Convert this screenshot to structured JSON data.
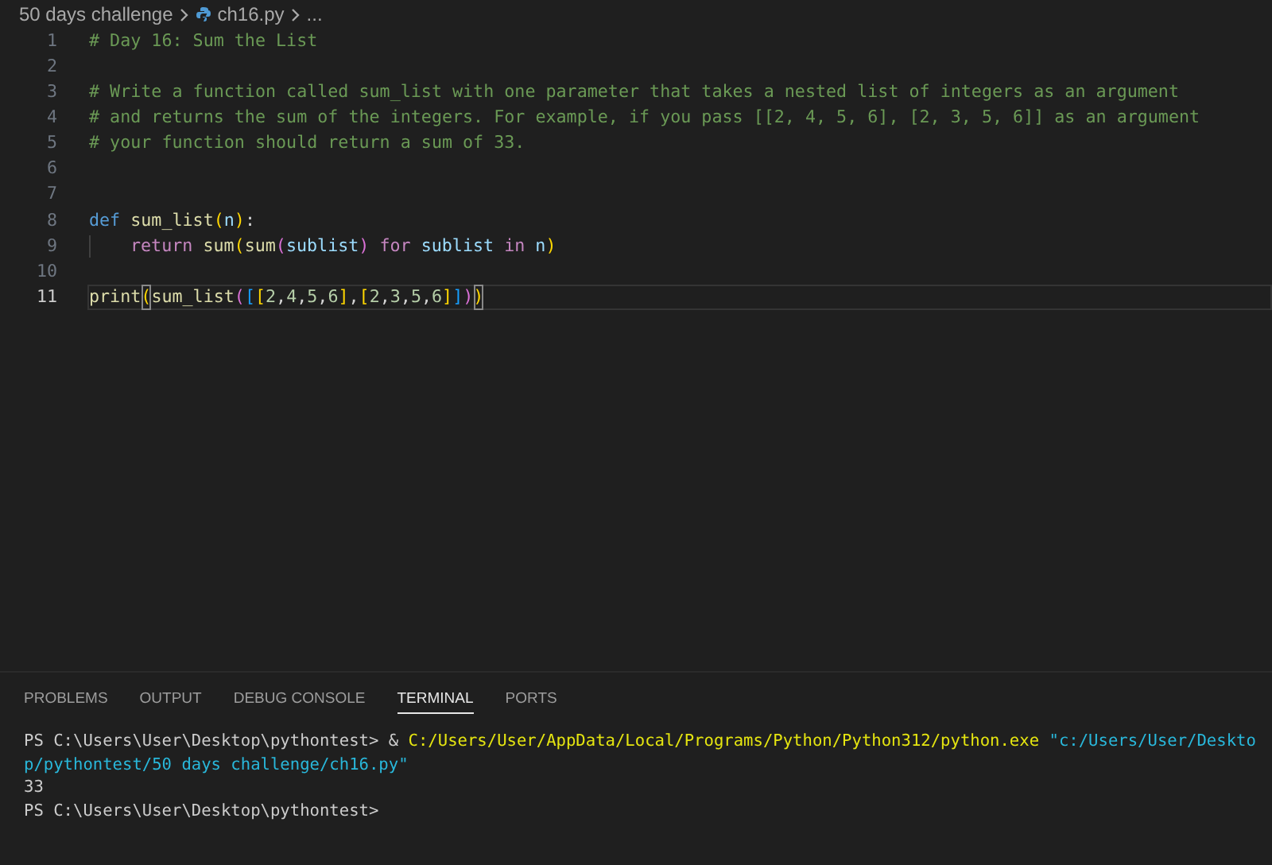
{
  "breadcrumb": [
    {
      "label": "50 days challenge",
      "kind": "folder"
    },
    {
      "label": "ch16.py",
      "kind": "file"
    },
    {
      "label": "...",
      "kind": "more"
    }
  ],
  "editor": {
    "lines": [
      {
        "number": "1",
        "current": false,
        "tokens": [
          {
            "text": "# Day 16: Sum the List",
            "kind": "comment"
          }
        ]
      },
      {
        "number": "2",
        "current": false
      },
      {
        "number": "3",
        "current": false,
        "tokens": [
          {
            "text": "# Write a function called sum_list with one parameter that takes a nested list of integers as an argument",
            "kind": "comment"
          }
        ]
      },
      {
        "number": "4",
        "current": false,
        "tokens": [
          {
            "text": "# and returns the sum of the integers. For example, if you pass [[2, 4, 5, 6], [2, 3, 5, 6]] as an argument",
            "kind": "comment"
          }
        ]
      },
      {
        "number": "5",
        "current": false,
        "tokens": [
          {
            "text": "# your function should return a sum of 33.",
            "kind": "comment"
          }
        ]
      },
      {
        "number": "6",
        "current": false
      },
      {
        "number": "7",
        "current": false
      },
      {
        "number": "8",
        "current": false,
        "tokens": [
          {
            "text": "def ",
            "kind": "keyword"
          },
          {
            "text": "sum_list",
            "kind": "function"
          },
          {
            "text": "(",
            "kind": "bracket1"
          },
          {
            "text": "n",
            "kind": "variable"
          },
          {
            "text": ")",
            "kind": "bracket1"
          },
          {
            "text": ":",
            "kind": "plain"
          }
        ]
      },
      {
        "number": "9",
        "current": false,
        "indented": true,
        "tokens": [
          {
            "text": "return ",
            "kind": "control"
          },
          {
            "text": "sum",
            "kind": "function"
          },
          {
            "text": "(",
            "kind": "bracket1"
          },
          {
            "text": "sum",
            "kind": "function"
          },
          {
            "text": "(",
            "kind": "bracket2"
          },
          {
            "text": "sublist",
            "kind": "variable"
          },
          {
            "text": ") ",
            "kind": "bracket2"
          },
          {
            "text": "for ",
            "kind": "control"
          },
          {
            "text": "sublist ",
            "kind": "variable"
          },
          {
            "text": "in ",
            "kind": "control"
          },
          {
            "text": "n",
            "kind": "variable"
          },
          {
            "text": ")",
            "kind": "bracket1"
          }
        ]
      },
      {
        "number": "10",
        "current": false
      },
      {
        "number": "11",
        "current": true,
        "tokens": [
          {
            "text": "print",
            "kind": "function"
          },
          {
            "text": "(",
            "kind": "bracket-match"
          },
          {
            "text": "sum_list",
            "kind": "function"
          },
          {
            "text": "(",
            "kind": "bracket2"
          },
          {
            "text": "[",
            "kind": "bracket3"
          },
          {
            "text": "[",
            "kind": "bracket1"
          },
          {
            "text": "2",
            "kind": "number"
          },
          {
            "text": ",",
            "kind": "plain"
          },
          {
            "text": "4",
            "kind": "number"
          },
          {
            "text": ",",
            "kind": "plain"
          },
          {
            "text": "5",
            "kind": "number"
          },
          {
            "text": ",",
            "kind": "plain"
          },
          {
            "text": "6",
            "kind": "number"
          },
          {
            "text": "]",
            "kind": "bracket1"
          },
          {
            "text": ",",
            "kind": "plain"
          },
          {
            "text": "[",
            "kind": "bracket1"
          },
          {
            "text": "2",
            "kind": "number"
          },
          {
            "text": ",",
            "kind": "plain"
          },
          {
            "text": "3",
            "kind": "number"
          },
          {
            "text": ",",
            "kind": "plain"
          },
          {
            "text": "5",
            "kind": "number"
          },
          {
            "text": ",",
            "kind": "plain"
          },
          {
            "text": "6",
            "kind": "number"
          },
          {
            "text": "]",
            "kind": "bracket1"
          },
          {
            "text": "]",
            "kind": "bracket3"
          },
          {
            "text": ")",
            "kind": "bracket2"
          },
          {
            "text": ")",
            "kind": "bracket-match"
          }
        ]
      }
    ]
  },
  "panel": {
    "tabs": [
      {
        "label": "PROBLEMS",
        "selected": false
      },
      {
        "label": "OUTPUT",
        "selected": false
      },
      {
        "label": "DEBUG CONSOLE",
        "selected": false
      },
      {
        "label": "TERMINAL",
        "selected": true
      },
      {
        "label": "PORTS",
        "selected": false
      }
    ],
    "terminal_lines": [
      [
        {
          "text": "PS C:\\Users\\User\\Desktop\\pythontest> & ",
          "kind": "plain"
        },
        {
          "text": "C:/Users/User/AppData/Local/Programs/Python/Python312/python.exe",
          "kind": "command"
        },
        {
          "text": " \"c:/Users/User/Deskto",
          "kind": "string"
        }
      ],
      [
        {
          "text": "p/pythontest/50 days challenge/ch16.py\"",
          "kind": "string"
        }
      ],
      [
        {
          "text": "33",
          "kind": "plain"
        }
      ],
      [
        {
          "text": "PS C:\\Users\\User\\Desktop\\pythontest>",
          "kind": "plain"
        }
      ]
    ]
  }
}
